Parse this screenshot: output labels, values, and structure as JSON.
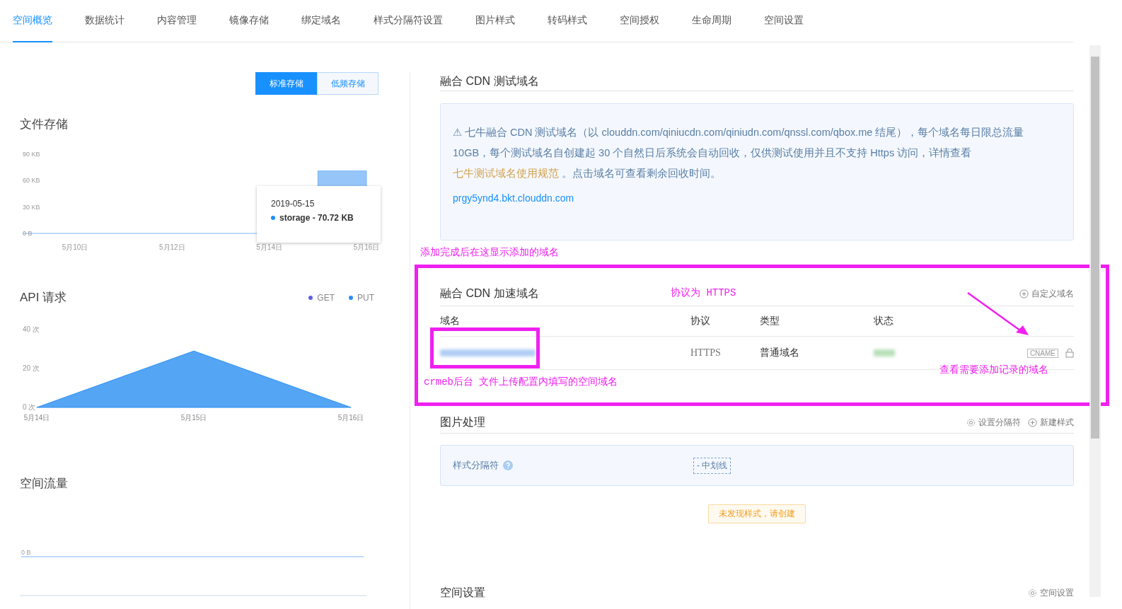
{
  "tabs": [
    {
      "label": "空间概览",
      "selected": true
    },
    {
      "label": "数据统计",
      "selected": false
    },
    {
      "label": "内容管理",
      "selected": false
    },
    {
      "label": "镜像存储",
      "selected": false
    },
    {
      "label": "绑定域名",
      "selected": false
    },
    {
      "label": "样式分隔符设置",
      "selected": false
    },
    {
      "label": "图片样式",
      "selected": false
    },
    {
      "label": "转码样式",
      "selected": false
    },
    {
      "label": "空间授权",
      "selected": false
    },
    {
      "label": "生命周期",
      "selected": false
    },
    {
      "label": "空间设置",
      "selected": false
    }
  ],
  "storage_type": [
    {
      "label": "标准存储",
      "selected": true
    },
    {
      "label": "低频存储",
      "selected": false
    }
  ],
  "file_storage": {
    "title": "文件存储",
    "chart_data": {
      "type": "area",
      "categories": [
        "5月10日",
        null,
        "5月12日",
        null,
        "5月14日",
        null,
        "5月16日"
      ],
      "series": [
        {
          "name": "storage",
          "color": "#7ab6f7",
          "values": [
            null,
            null,
            null,
            null,
            null,
            71,
            71
          ]
        }
      ],
      "ylim": [
        0,
        90
      ],
      "yticks": [
        {
          "value": 0,
          "label": "0 B"
        },
        {
          "value": 30,
          "label": "30 KB"
        },
        {
          "value": 60,
          "label": "60 KB"
        },
        {
          "value": 90,
          "label": "90 KB"
        }
      ]
    },
    "tooltip": {
      "date": "2019-05-15",
      "value": "- 70.72 KB"
    }
  },
  "api_requests": {
    "title": "API 请求",
    "chart_data": {
      "type": "area",
      "categories": [
        "5月14日",
        "5月15日",
        "5月16日"
      ],
      "series": [
        {
          "name": "GET",
          "color": "#5b5fe6",
          "values": [
            null,
            null,
            null
          ]
        },
        {
          "name": "PUT",
          "color": "#2b8ef2",
          "values": [
            0,
            29,
            0
          ]
        }
      ],
      "ylim": [
        0,
        40
      ],
      "yticks": [
        {
          "value": 0,
          "label": "0 次"
        },
        {
          "value": 20,
          "label": "20 次"
        },
        {
          "value": 40,
          "label": "40 次"
        }
      ]
    }
  },
  "space_traffic": {
    "title": "空间流量",
    "axis_label": "0 B"
  },
  "test_domain": {
    "title": "融合 CDN 测试域名",
    "notice": "⚠ 七牛融合 CDN 测试域名（以 clouddn.com/qiniucdn.com/qiniudn.com/qnssl.com/qbox.me 结尾），每个域名每日限总流量 10GB，每个测试域名自创建起 30 个自然日后系统会自动回收，仅供测试使用并且不支持 Https 访问，详情查看",
    "notice_link": "七牛测试域名使用规范",
    "notice_tail": "。点击域名可查看剩余回收时间。",
    "domain": "prgy5ynd4.bkt.clouddn.com"
  },
  "cdn_domain": {
    "title": "融合 CDN 加速域名",
    "action": "自定义域名",
    "columns": [
      "域名",
      "协议",
      "类型",
      "状态"
    ],
    "rows": [
      {
        "protocol": "HTTPS",
        "type": "普通域名",
        "tag": "CNAME"
      }
    ]
  },
  "image_processing": {
    "title": "图片处理",
    "actions": [
      "设置分隔符",
      "新建样式"
    ],
    "separator_label": "样式分隔符",
    "separator_value": "- 中划线",
    "empty_notice": "未发现样式，请创建"
  },
  "space_settings": {
    "title": "空间设置",
    "action": "空间设置"
  },
  "annotations": [
    "添加完成后在这显示添加的域名",
    "协议为 HTTPS",
    "crmeb后台 文件上传配置内填写的空间域名",
    "查看需要添加记录的域名"
  ]
}
